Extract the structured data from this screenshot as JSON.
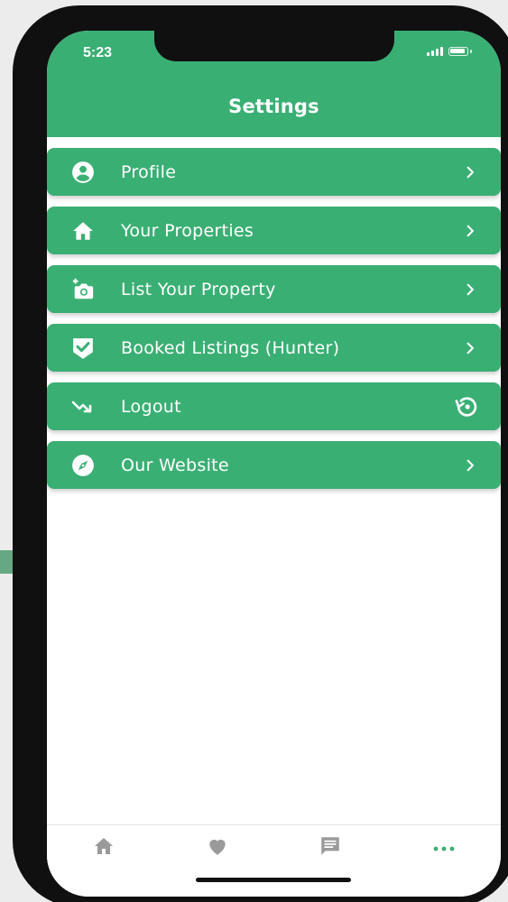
{
  "status_bar": {
    "time": "5:23"
  },
  "header": {
    "title": "Settings"
  },
  "menu": {
    "items": [
      {
        "label": "Profile",
        "icon": "account-circle-icon",
        "trailing": "chevron-right-icon"
      },
      {
        "label": "Your Properties",
        "icon": "home-icon",
        "trailing": "chevron-right-icon"
      },
      {
        "label": "List Your Property",
        "icon": "add-camera-icon",
        "trailing": "chevron-right-icon"
      },
      {
        "label": "Booked Listings (Hunter)",
        "icon": "verified-check-icon",
        "trailing": "chevron-right-icon"
      },
      {
        "label": "Logout",
        "icon": "trending-arrow-icon",
        "trailing": "restore-icon"
      },
      {
        "label": "Our Website",
        "icon": "compass-icon",
        "trailing": "chevron-right-icon"
      }
    ]
  },
  "tabbar": {
    "tabs": [
      {
        "icon": "home-icon",
        "active": false
      },
      {
        "icon": "heart-icon",
        "active": false
      },
      {
        "icon": "chat-icon",
        "active": false
      },
      {
        "icon": "more-icon",
        "active": true
      }
    ]
  },
  "colors": {
    "accent": "#3aaf74",
    "tab_inactive": "#9a9a9a",
    "tab_active": "#3aaf74"
  }
}
